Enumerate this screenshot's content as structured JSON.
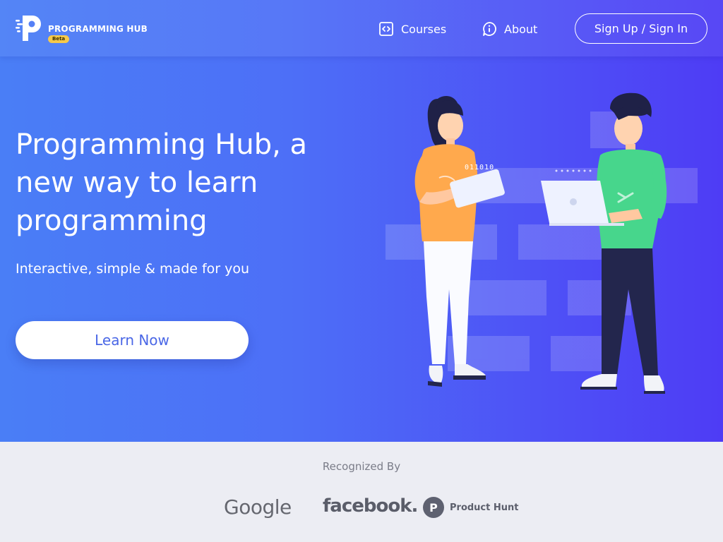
{
  "brand": {
    "name": "PROGRAMMING HUB",
    "badge": "Beta",
    "logo_icon": "p-logo-icon"
  },
  "nav": {
    "items": [
      {
        "label": "Courses",
        "icon": "code-icon"
      },
      {
        "label": "About",
        "icon": "info-icon"
      }
    ],
    "auth_label": "Sign Up / Sign In"
  },
  "hero": {
    "headline": "Programming Hub, a new way to learn programming",
    "subheadline": "Interactive, simple & made for you",
    "cta_label": "Learn Now",
    "illustration_text": {
      "tablet_binary": "011010"
    }
  },
  "recognized": {
    "title": "Recognized By",
    "brands": [
      "Google",
      "facebook.",
      "Product Hunt"
    ],
    "product_hunt_mark": "P"
  },
  "colors": {
    "hero_gradient_start": "#4a7ef6",
    "hero_gradient_end": "#4e3cf5",
    "cta_text": "#4a67e6",
    "footer_bg": "#ecedf3",
    "badge": "#f6c94a",
    "shirt_orange": "#ffa94d",
    "shirt_green": "#47d68c"
  }
}
